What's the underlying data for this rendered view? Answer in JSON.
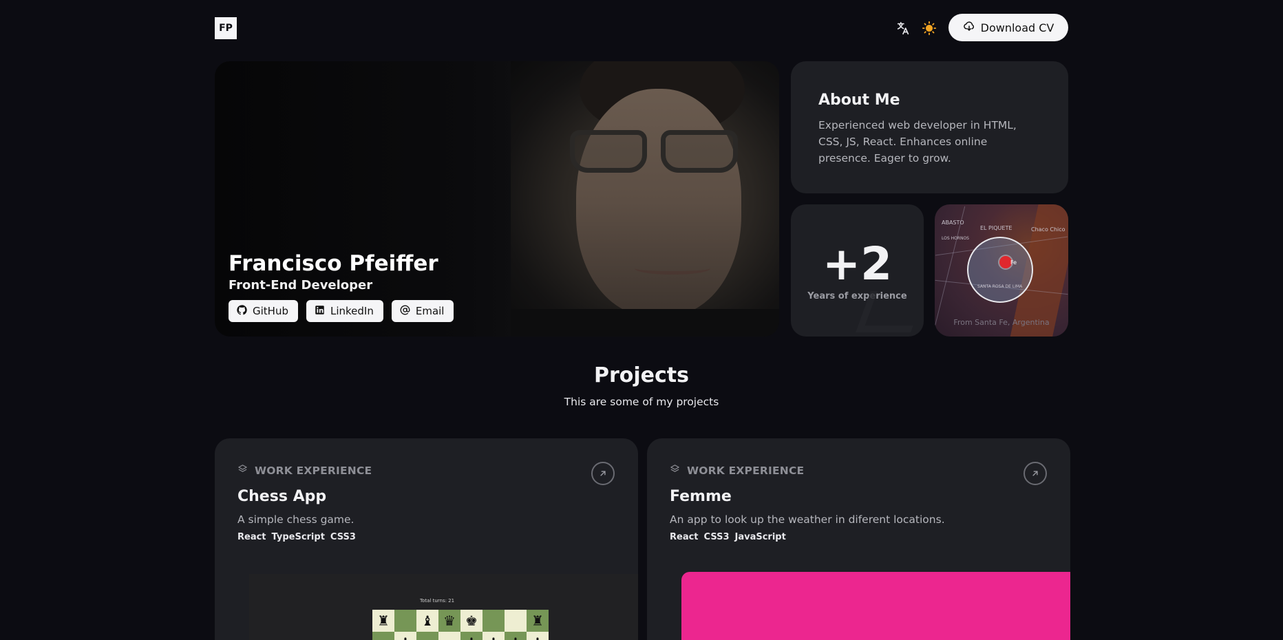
{
  "header": {
    "logo": "FP",
    "download_label": "Download CV",
    "icons": [
      "translate-icon",
      "sun-icon",
      "cloud-download-icon"
    ]
  },
  "hero": {
    "name": "Francisco Pfeiffer",
    "role": "Front-End Developer",
    "links": [
      {
        "label": "GitHub",
        "icon": "github-icon"
      },
      {
        "label": "LinkedIn",
        "icon": "linkedin-icon"
      },
      {
        "label": "Email",
        "icon": "at-icon"
      }
    ]
  },
  "about": {
    "title": "About Me",
    "text": "Experienced web developer in HTML, CSS, JS, React. Enhances online presence. Eager to grow."
  },
  "experience": {
    "value": "+2",
    "label": "Years of experience"
  },
  "location": {
    "caption": "From Santa Fe, Argentina",
    "map_labels": [
      "ABASTO",
      "EL PIQUETE",
      "Chaco Chico",
      "Fe",
      "LOS HORNOS",
      "SANTA ROSA DE LIMA"
    ]
  },
  "projects": {
    "title": "Projects",
    "subtitle": "This are some of my projects",
    "items": [
      {
        "tag": "WORK EXPERIENCE",
        "name": "Chess App",
        "description": "A simple chess game.",
        "techs": [
          "React",
          "TypeScript",
          "CSS3"
        ],
        "preview_label": "Total turns: 21"
      },
      {
        "tag": "WORK EXPERIENCE",
        "name": "Femme",
        "description": "An app to look up the weather in diferent locations.",
        "techs": [
          "React",
          "CSS3",
          "JavaScript"
        ],
        "preview_color": "#ec268f"
      }
    ]
  },
  "colors": {
    "background": "#0c0c12",
    "card": "#1e1f24",
    "accent_pink": "#ec268f",
    "sun": "#f5a623"
  }
}
